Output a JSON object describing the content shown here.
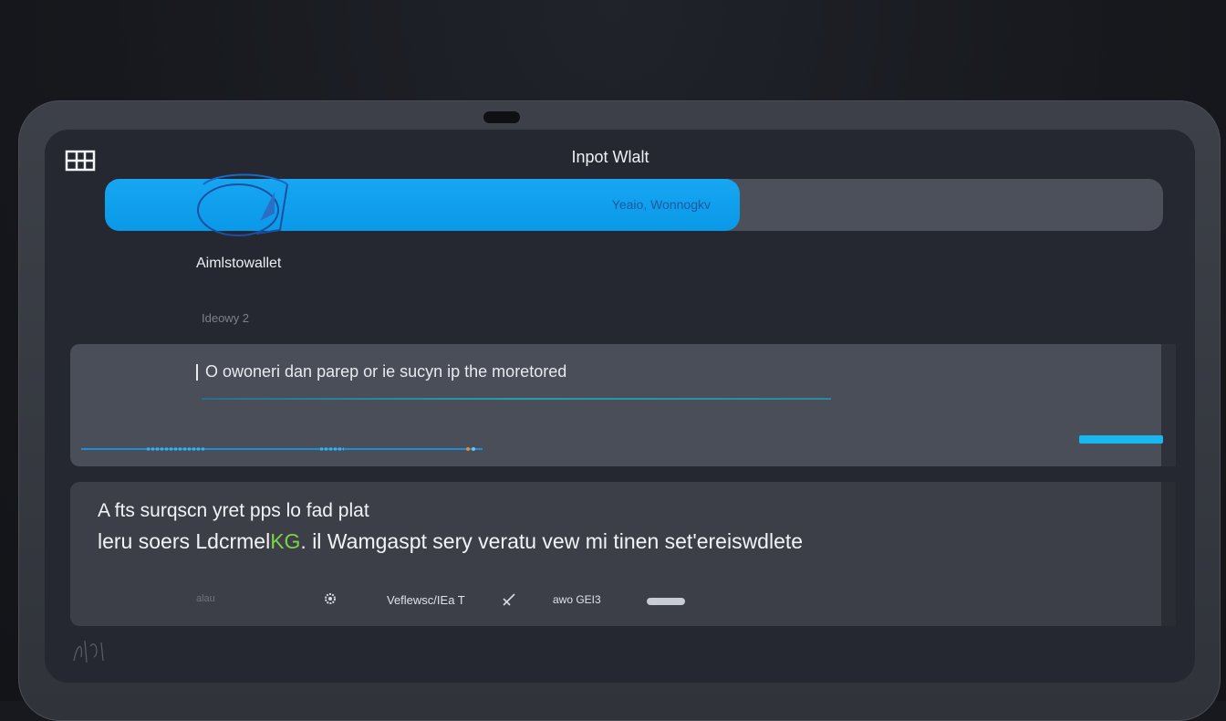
{
  "header": {
    "title": "Inpot Wlalt"
  },
  "progress": {
    "fraction": 0.6,
    "label": "Yeaio, Wonnogkv"
  },
  "wallet": {
    "name": "Aimlstowallet",
    "subtitle": "Ideowy 2"
  },
  "input": {
    "value": "O owoneri dan parep or ie sucyn ip the moretored"
  },
  "info": {
    "line1": "A fts surqscn yret pps lo fad plat",
    "line2_before": "leru soers Ldcrmel",
    "line2_accent": "KG",
    "line2_after": ". il Wamgaspt sery veratu vew mi tinen set'ereiswdlete"
  },
  "footer": {
    "item1": "alau",
    "item2": "Veflewsc/IEa T",
    "item3": "awo GEI3"
  },
  "colors": {
    "accent": "#0a99e8",
    "highlight": "#7fd14a",
    "action": "#19b6f0"
  },
  "icons": {
    "menu": "grid-icon",
    "progress_glyph": "bird-icon",
    "footer_settings": "gear-icon",
    "footer_edit": "pencil-icon"
  }
}
